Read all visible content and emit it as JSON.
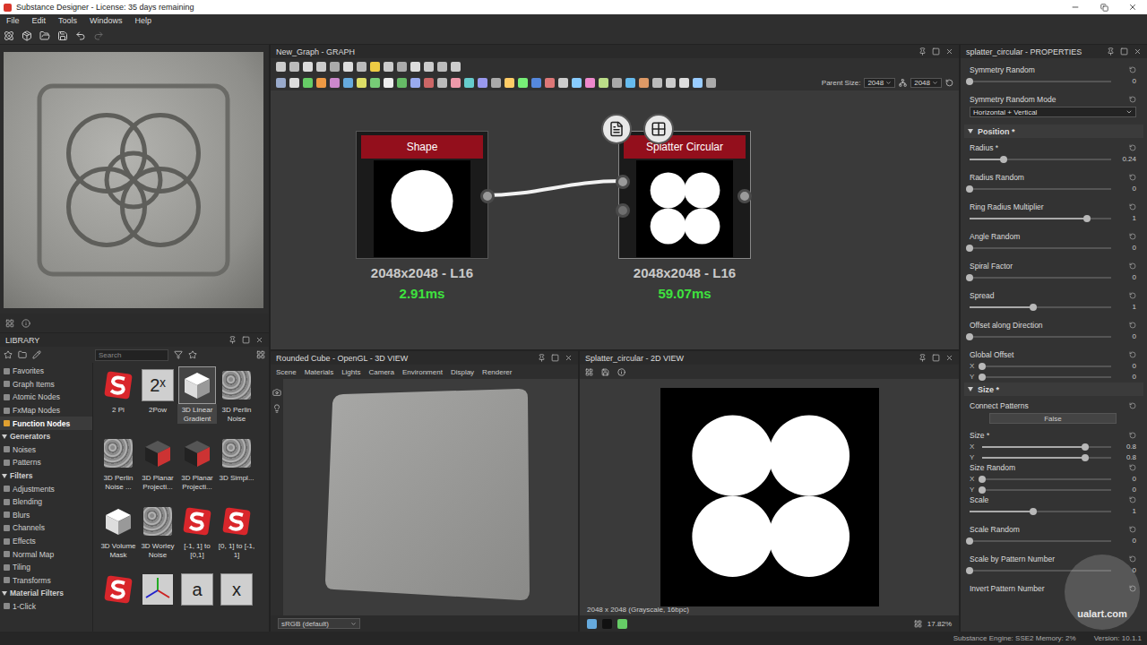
{
  "window": {
    "title": "Substance Designer - License: 35 days remaining"
  },
  "menu": [
    "File",
    "Edit",
    "Tools",
    "Windows",
    "Help"
  ],
  "graph": {
    "title": "New_Graph - GRAPH",
    "parent_size_label": "Parent Size:",
    "parent_size": "2048",
    "size": "2048",
    "nodes": [
      {
        "title": "Shape",
        "resolution": "2048x2048 - L16",
        "time": "2.91ms",
        "selected": false,
        "thumbnail": "shape"
      },
      {
        "title": "Splatter Circular",
        "resolution": "2048x2048 - L16",
        "time": "59.07ms",
        "selected": true,
        "thumbnail": "splatter"
      }
    ]
  },
  "library": {
    "title": "LIBRARY",
    "search": "Search",
    "tree": [
      {
        "label": "Favorites",
        "kind": "item",
        "selected": false
      },
      {
        "label": "Graph Items",
        "kind": "item",
        "selected": false
      },
      {
        "label": "Atomic Nodes",
        "kind": "item",
        "selected": false
      },
      {
        "label": "FxMap Nodes",
        "kind": "item",
        "selected": false
      },
      {
        "label": "Function Nodes",
        "kind": "item",
        "selected": true
      },
      {
        "label": "Generators",
        "kind": "section",
        "selected": false,
        "expanded": true
      },
      {
        "label": "Noises",
        "kind": "item",
        "selected": false
      },
      {
        "label": "Patterns",
        "kind": "item",
        "selected": false
      },
      {
        "label": "Filters",
        "kind": "section",
        "selected": false,
        "expanded": true
      },
      {
        "label": "Adjustments",
        "kind": "item",
        "selected": false
      },
      {
        "label": "Blending",
        "kind": "item",
        "selected": false
      },
      {
        "label": "Blurs",
        "kind": "item",
        "selected": false
      },
      {
        "label": "Channels",
        "kind": "item",
        "selected": false
      },
      {
        "label": "Effects",
        "kind": "item",
        "selected": false
      },
      {
        "label": "Normal Map",
        "kind": "item",
        "selected": false
      },
      {
        "label": "Tiling",
        "kind": "item",
        "selected": false
      },
      {
        "label": "Transforms",
        "kind": "item",
        "selected": false
      },
      {
        "label": "Material Filters",
        "kind": "section",
        "selected": false,
        "expanded": true
      },
      {
        "label": "1-Click",
        "kind": "item",
        "selected": false
      }
    ],
    "items": [
      {
        "label": "2 Pi",
        "icon": "s-logo",
        "selected": false
      },
      {
        "label": "2Pow",
        "icon": "glyph",
        "glyph": "2ˣ",
        "selected": false
      },
      {
        "label": "3D Linear Gradient",
        "icon": "cube",
        "selected": true
      },
      {
        "label": "3D Perlin Noise",
        "icon": "noise",
        "selected": false
      },
      {
        "label": "3D Perlin Noise ...",
        "icon": "noise",
        "selected": false
      },
      {
        "label": "3D Planar Projecti...",
        "icon": "dark-cube",
        "selected": false
      },
      {
        "label": "3D Planar Projecti...",
        "icon": "dark-cube",
        "selected": false
      },
      {
        "label": "3D Simpl...",
        "icon": "noise",
        "selected": false
      },
      {
        "label": "3D Volume Mask",
        "icon": "cube",
        "selected": false
      },
      {
        "label": "3D Worley Noise",
        "icon": "noise",
        "selected": false
      },
      {
        "label": "[-1, 1] to [0,1]",
        "icon": "s-logo",
        "selected": false
      },
      {
        "label": "[0, 1] to [-1, 1]",
        "icon": "s-logo",
        "selected": false
      },
      {
        "label": "",
        "icon": "s-logo",
        "selected": false
      },
      {
        "label": "",
        "icon": "axis",
        "selected": false
      },
      {
        "label": "",
        "icon": "glyph",
        "glyph": "a",
        "selected": false
      },
      {
        "label": "",
        "icon": "glyph",
        "glyph": "x",
        "selected": false
      }
    ]
  },
  "view3d": {
    "title": "Rounded Cube - OpenGL - 3D VIEW",
    "menu": [
      "Scene",
      "Materials",
      "Lights",
      "Camera",
      "Environment",
      "Display",
      "Renderer"
    ],
    "color_space": "sRGB (default)"
  },
  "view2d": {
    "title": "Splatter_circular - 2D VIEW",
    "image_info": "2048 x 2048 (Grayscale, 16bpc)",
    "zoom": "17.82%"
  },
  "properties": {
    "title": "splatter_circular - PROPERTIES",
    "rows": [
      {
        "kind": "slider",
        "label": "Symmetry Random",
        "level": 0,
        "reading": "0"
      },
      {
        "kind": "dropdown",
        "label": "Symmetry Random Mode",
        "value": "Horizontal + Vertical"
      },
      {
        "kind": "section",
        "label": "Position *",
        "expanded": true
      },
      {
        "kind": "slider",
        "label": "Radius *",
        "level": 0.24,
        "reading": "0.24"
      },
      {
        "kind": "slider",
        "label": "Radius Random",
        "level": 0,
        "reading": "0"
      },
      {
        "kind": "slider",
        "label": "Ring Radius Multiplier",
        "level": 0.83,
        "reading": "1"
      },
      {
        "kind": "slider",
        "label": "Angle Random",
        "level": 0,
        "reading": "0"
      },
      {
        "kind": "slider",
        "label": "Spiral Factor",
        "level": 0,
        "reading": "0"
      },
      {
        "kind": "slider",
        "label": "Spread",
        "level": 0.45,
        "reading": "1"
      },
      {
        "kind": "slider",
        "label": "Offset along Direction",
        "level": 0,
        "reading": "0"
      },
      {
        "kind": "xy",
        "label": "Global Offset",
        "values": [
          {
            "axis": "X",
            "level": 0,
            "reading": "0"
          },
          {
            "axis": "Y",
            "level": 0,
            "reading": "0"
          }
        ]
      },
      {
        "kind": "section",
        "label": "Size *",
        "expanded": true
      },
      {
        "kind": "button",
        "label": "Connect Patterns",
        "value": "False"
      },
      {
        "kind": "xy",
        "label": "Size *",
        "values": [
          {
            "axis": "X",
            "level": 0.8,
            "reading": "0.8"
          },
          {
            "axis": "Y",
            "level": 0.8,
            "reading": "0.8"
          }
        ]
      },
      {
        "kind": "xy",
        "label": "Size Random",
        "values": [
          {
            "axis": "X",
            "level": 0,
            "reading": "0"
          },
          {
            "axis": "Y",
            "level": 0,
            "reading": "0"
          }
        ]
      },
      {
        "kind": "slider",
        "label": "Scale",
        "level": 0.45,
        "reading": "1"
      },
      {
        "kind": "slider",
        "label": "Scale Random",
        "level": 0,
        "reading": "0"
      },
      {
        "kind": "slider",
        "label": "Scale by Pattern Number",
        "level": 0,
        "reading": "0"
      },
      {
        "kind": "label",
        "label": "Invert Pattern Number"
      }
    ]
  },
  "status_bar": {
    "engine": "Substance Engine: SSE2  Memory: 2%",
    "version": "Version: 10.1.1"
  },
  "watermark": "ualart.com"
}
